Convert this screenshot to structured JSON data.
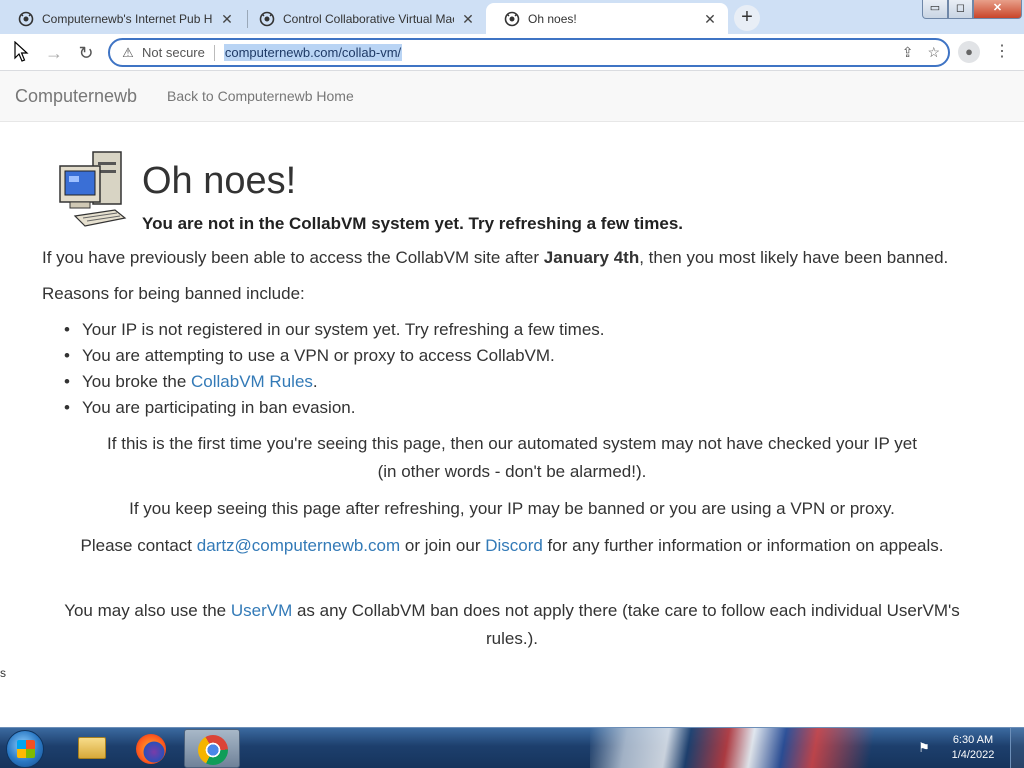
{
  "browser": {
    "tabs": [
      {
        "title": "Computernewb's Internet Pub Hub",
        "active": false
      },
      {
        "title": "Control Collaborative Virtual Machines",
        "active": false
      },
      {
        "title": "Oh noes!",
        "active": true
      }
    ],
    "new_tab_symbol": "+",
    "window_buttons": {
      "minimize": "▭",
      "maximize": "◻",
      "close": "✕"
    },
    "security_label": "Not secure",
    "url": "computernewb.com/collab-vm/"
  },
  "site": {
    "brand": "Computernewb",
    "home_link": "Back to Computernewb Home"
  },
  "page": {
    "heading": "Oh noes!",
    "subheading": "You are not in the CollabVM system yet. Try refreshing a few times.",
    "banned_intro_prefix": "If you have previously been able to access the CollabVM site after ",
    "banned_intro_date": "January 4th",
    "banned_intro_suffix": ", then you most likely have been banned.",
    "reasons_title": "Reasons for being banned include:",
    "reasons": [
      "Your IP is not registered in our system yet. Try refreshing a few times.",
      "You are attempting to use a VPN or proxy to access CollabVM.",
      "You broke the ",
      "You are participating in ban evasion."
    ],
    "rules_link": "CollabVM Rules",
    "rules_suffix": ".",
    "first_time_line1": "If this is the first time you're seeing this page, then our automated system may not have checked your IP yet",
    "first_time_line2": "(in other words - don't be alarmed!).",
    "keep_seeing": "If you keep seeing this page after refreshing, your IP may be banned or you are using a VPN or proxy.",
    "contact_prefix": "Please contact ",
    "contact_email": "dartz@computernewb.com",
    "contact_mid": " or join our ",
    "contact_discord": "Discord",
    "contact_suffix": " for any further information or information on appeals.",
    "uservm_prefix": "You may also use the ",
    "uservm_link": "UserVM",
    "uservm_suffix": " as any CollabVM ban does not apply there (take care to follow each individual UserVM's rules.).",
    "stray_char": "s"
  },
  "taskbar": {
    "time": "6:30 AM",
    "date": "1/4/2022"
  },
  "colors": {
    "link": "#337ab7",
    "tabstrip": "#cfe0f5",
    "omnibox_border": "#3f74c4",
    "url_selection": "#b9d4f4"
  }
}
